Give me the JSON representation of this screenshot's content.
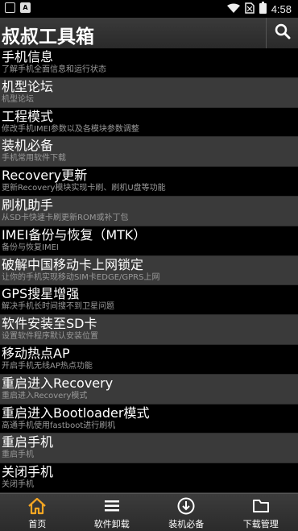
{
  "status_bar": {
    "time": "4:58",
    "left_icons": [
      "notification-square-icon",
      "notification-a-icon"
    ],
    "right_icons": [
      "wifi-icon",
      "no-sim-icon",
      "battery-icon"
    ]
  },
  "header": {
    "title": "叔叔工具箱",
    "search_icon": "search-icon"
  },
  "list": {
    "items": [
      {
        "title": "手机信息",
        "subtitle": "了解手机全面信息和运行状态"
      },
      {
        "title": "机型论坛",
        "subtitle": "机型论坛"
      },
      {
        "title": "工程模式",
        "subtitle": "修改手机IMEI参数以及各模块参数调整"
      },
      {
        "title": "装机必备",
        "subtitle": "手机常用软件下载"
      },
      {
        "title": "Recovery更新",
        "subtitle": "更新Recovery模块实现卡刷、刷机U盘等功能"
      },
      {
        "title": "刷机助手",
        "subtitle": "从SD卡快速卡刷更新ROM或补丁包"
      },
      {
        "title": "IMEI备份与恢复（MTK）",
        "subtitle": "备份与恢复IMEI"
      },
      {
        "title": "破解中国移动卡上网锁定",
        "subtitle": "让你的手机实现移动SIM卡EDGE/GPRS上网"
      },
      {
        "title": "GPS搜星增强",
        "subtitle": "解决手机长时间搜不到卫星问题"
      },
      {
        "title": "软件安装至SD卡",
        "subtitle": "设置软件程序默认安装位置"
      },
      {
        "title": "移动热点AP",
        "subtitle": "开启手机无线AP热点功能"
      },
      {
        "title": "重启进入Recovery",
        "subtitle": "重启进入Recovery模式"
      },
      {
        "title": "重启进入Bootloader模式",
        "subtitle": "高通手机使用fastboot进行刷机"
      },
      {
        "title": "重启手机",
        "subtitle": "重启手机"
      },
      {
        "title": "关闭手机",
        "subtitle": "关闭手机"
      }
    ]
  },
  "bottom_nav": {
    "items": [
      {
        "label": "首页",
        "icon": "home-icon",
        "active": true
      },
      {
        "label": "软件卸载",
        "icon": "list-icon",
        "active": false
      },
      {
        "label": "装机必备",
        "icon": "download-circle-icon",
        "active": false
      },
      {
        "label": "下载管理",
        "icon": "folder-icon",
        "active": false
      }
    ]
  },
  "colors": {
    "accent": "#f5a623",
    "list_light": "#3a3a3a",
    "list_dark": "#000000",
    "subtitle": "#9a9a9a"
  }
}
